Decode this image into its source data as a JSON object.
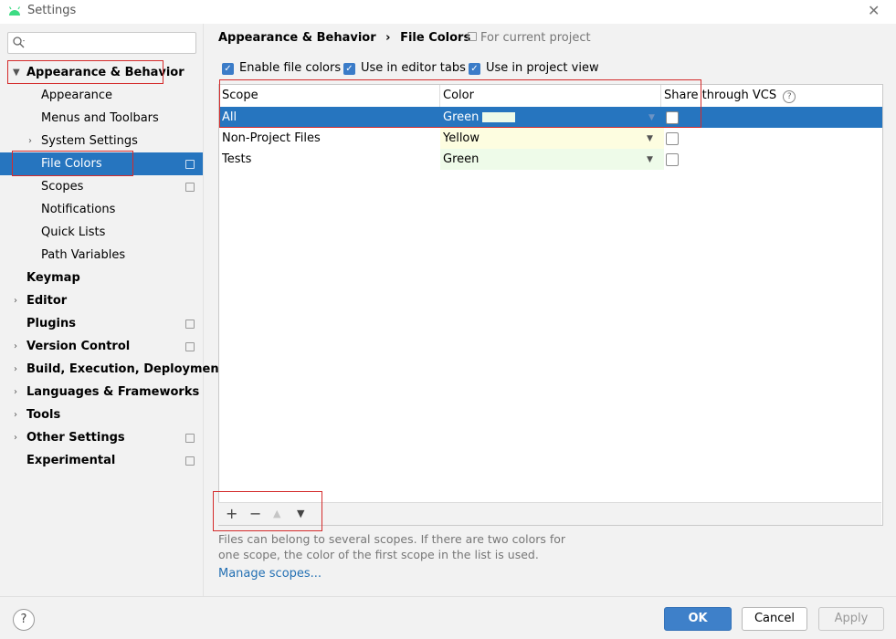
{
  "window": {
    "title": "Settings",
    "close": "✕"
  },
  "search": {
    "placeholder": "",
    "icon": "search-icon"
  },
  "sidebar": {
    "items": [
      {
        "label": "Appearance & Behavior"
      },
      {
        "label": "Appearance"
      },
      {
        "label": "Menus and Toolbars"
      },
      {
        "label": "System Settings"
      },
      {
        "label": "File Colors"
      },
      {
        "label": "Scopes"
      },
      {
        "label": "Notifications"
      },
      {
        "label": "Quick Lists"
      },
      {
        "label": "Path Variables"
      },
      {
        "label": "Keymap"
      },
      {
        "label": "Editor"
      },
      {
        "label": "Plugins"
      },
      {
        "label": "Version Control"
      },
      {
        "label": "Build, Execution, Deployment"
      },
      {
        "label": "Languages & Frameworks"
      },
      {
        "label": "Tools"
      },
      {
        "label": "Other Settings"
      },
      {
        "label": "Experimental"
      }
    ]
  },
  "breadcrumb": {
    "parent": "Appearance & Behavior",
    "sep": "›",
    "current": "File Colors",
    "scope": "For current project"
  },
  "options": {
    "enable_file_colors": "Enable file colors",
    "use_in_editor_tabs": "Use in editor tabs",
    "use_in_project_view": "Use in project view"
  },
  "table": {
    "headers": [
      "Scope",
      "Color",
      "Share through VCS"
    ],
    "rows": [
      {
        "scope": "All",
        "color": "Green",
        "shared": false
      },
      {
        "scope": "Non-Project Files",
        "color": "Yellow",
        "shared": false
      },
      {
        "scope": "Tests",
        "color": "Green",
        "shared": false
      }
    ]
  },
  "toolbar": {
    "add": "+",
    "remove": "−",
    "up": "▲",
    "down": "▼"
  },
  "note": "Files can belong to several scopes. If there are two colors for one scope, the color of the first scope in the list is used.",
  "manage_link": "Manage scopes...",
  "footer": {
    "help": "?",
    "ok": "OK",
    "cancel": "Cancel",
    "apply": "Apply"
  },
  "colors": {
    "accent": "#2675bf",
    "yellow_bg": "#fdfde0",
    "green_bg": "#eefbe9",
    "highlight": "#d42b2b"
  }
}
